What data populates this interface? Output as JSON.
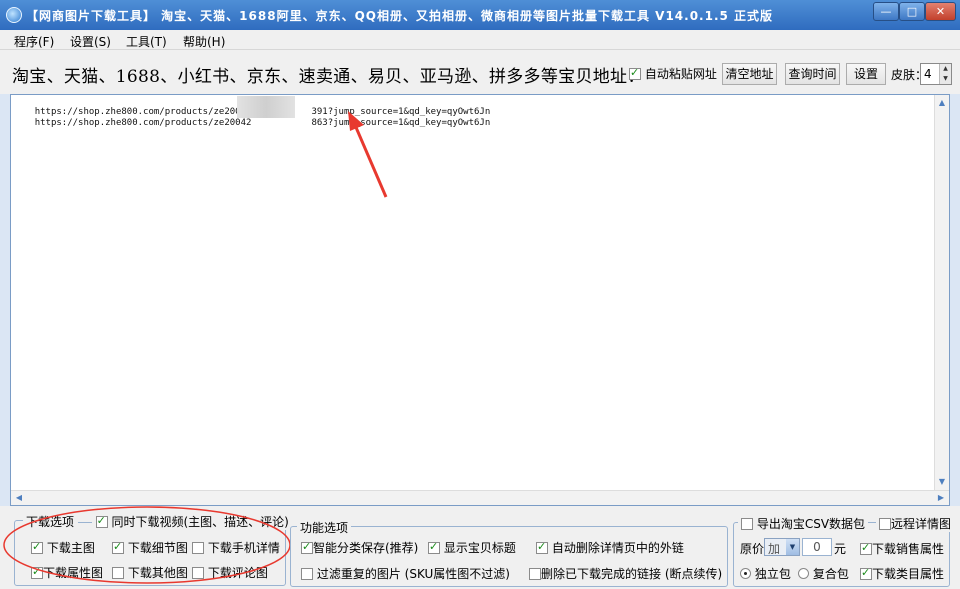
{
  "window": {
    "title": "【网商图片下载工具】 淘宝、天猫、1688阿里、京东、QQ相册、又拍相册、微商相册等图片批量下载工具 V14.0.1.5 正式版",
    "minimize": "—",
    "maximize": "□",
    "close": "✕"
  },
  "menu": [
    "程序(F)",
    "设置(S)",
    "工具(T)",
    "帮助(H)"
  ],
  "toolbar": {
    "headline": "淘宝、天猫、1688、小红书、京东、速卖通、易贝、亚马逊、拼多多等宝贝地址：",
    "auto_paste": "自动粘贴网址",
    "auto_paste_checked": true,
    "clear_button": "清空地址",
    "query_button": "查询时间",
    "settings_button": "设置",
    "skin_label": "皮肤：",
    "skin_value": "4"
  },
  "editor": {
    "lines": [
      {
        "prefix": "https://shop.zhe800.com/products/ze20040",
        "suffix": "391?jump_source=1&qd_key=qyOwt6Jn"
      },
      {
        "prefix": "https://shop.zhe800.com/products/ze20042",
        "suffix": "863?jump_source=1&qd_key=qyOwt6Jn"
      }
    ]
  },
  "download_options": {
    "legend": "下载选项",
    "video_label": "同时下载视频(主图、描述、评论)",
    "video_checked": true,
    "items": [
      {
        "label": "下载主图",
        "checked": true
      },
      {
        "label": "下载细节图",
        "checked": true
      },
      {
        "label": "下载手机详情",
        "checked": false
      },
      {
        "label": "下载属性图",
        "checked": true
      },
      {
        "label": "下载其他图",
        "checked": false
      },
      {
        "label": "下载评论图",
        "checked": false
      }
    ]
  },
  "function_options": {
    "legend": "功能选项",
    "items": [
      {
        "label": "智能分类保存(推荐)",
        "checked": true
      },
      {
        "label": "显示宝贝标题",
        "checked": true
      },
      {
        "label": "自动删除详情页中的外链",
        "checked": true
      },
      {
        "label": "过滤重复的图片 (SKU属性图不过滤)",
        "checked": false
      },
      {
        "label": "删除已下载完成的链接 (断点续传)",
        "checked": false
      }
    ]
  },
  "csv_options": {
    "export_label": "导出淘宝CSV数据包",
    "export_checked": false,
    "remote_label": "远程详情图",
    "remote_checked": false,
    "price_label": "原价",
    "price_mode": "加",
    "price_value": "0",
    "price_unit": "元",
    "sales_attr": "下载销售属性",
    "sales_attr_checked": true,
    "single_pack": "独立包",
    "single_pack_selected": true,
    "merge_pack": "复合包",
    "merge_pack_selected": false,
    "category_attr": "下载类目属性",
    "category_attr_checked": true
  },
  "colors": {
    "annotation_red": "#e8392f",
    "titlebar_blue": "#3a78c9"
  }
}
